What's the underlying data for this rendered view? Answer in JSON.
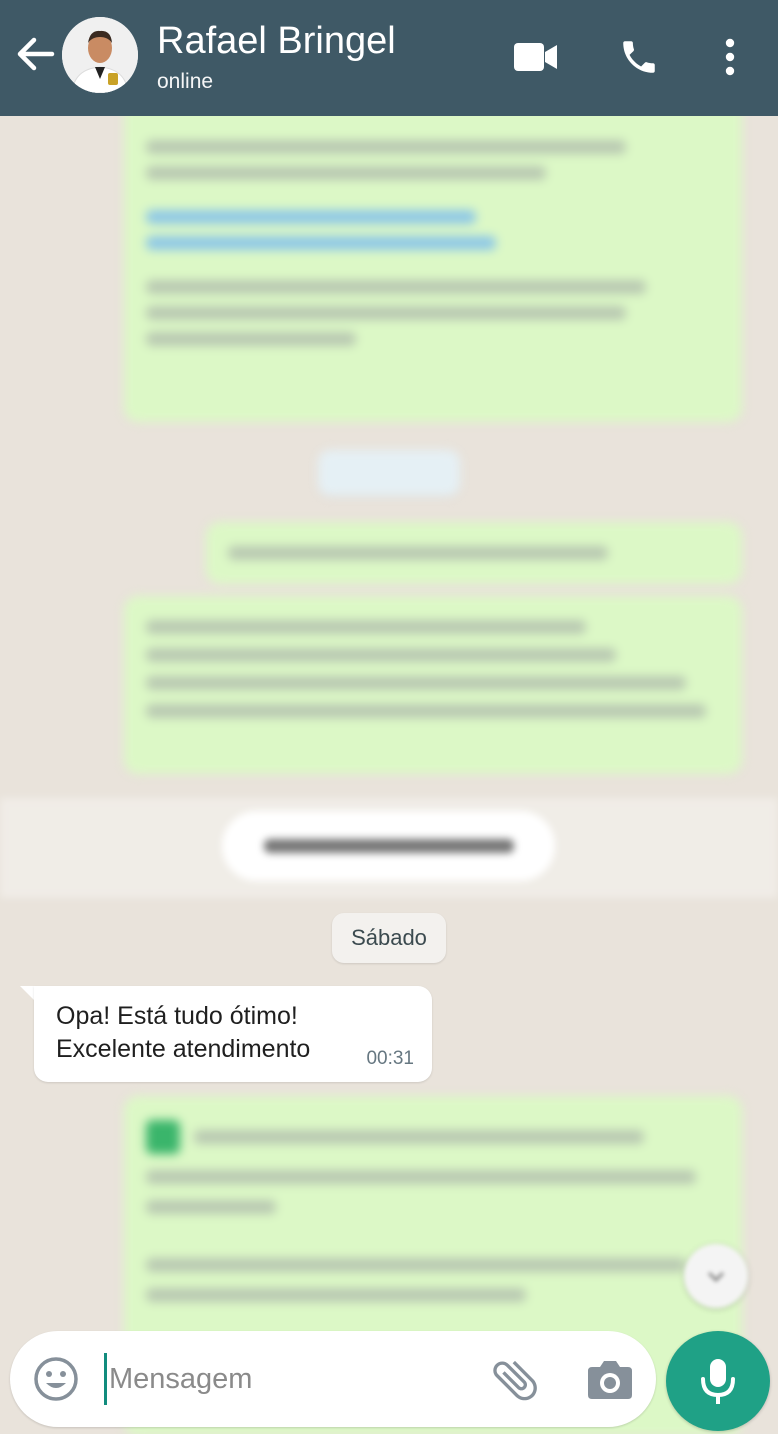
{
  "header": {
    "contact_name": "Rafael Bringel",
    "status": "online",
    "icons": [
      "back-arrow-icon",
      "video-call-icon",
      "phone-icon",
      "more-vert-icon"
    ]
  },
  "chat": {
    "date_separator": "Sábado",
    "incoming_message": {
      "line1": "Opa! Está tudo ótimo!",
      "line2": "Excelente atendimento",
      "time": "00:31"
    }
  },
  "composer": {
    "placeholder": "Mensagem",
    "value": "",
    "icons": [
      "emoji-icon",
      "attach-icon",
      "camera-icon",
      "mic-icon"
    ]
  },
  "colors": {
    "header": "#3f5966",
    "outgoing_bubble": "#dcf8c6",
    "chat_background": "#e9e3db",
    "accent": "#1fa186"
  }
}
